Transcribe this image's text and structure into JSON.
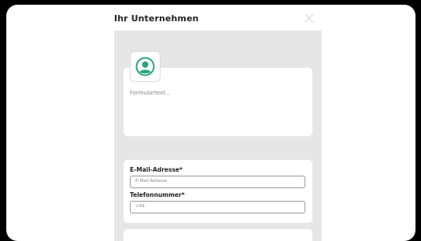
{
  "modal": {
    "title": "Ihr Unternehmen"
  },
  "form": {
    "text_placeholder": "Formulartext...",
    "email_label": "E-Mail-Adresse*",
    "email_placeholder": "E-Mail-Adresse",
    "phone_label": "Telefonnummer*",
    "phone_placeholder": "+49"
  },
  "icons": {
    "close": "close-icon",
    "avatar": "user-avatar-icon"
  },
  "colors": {
    "accent": "#27a67a",
    "panel": "#e6e6e6"
  }
}
